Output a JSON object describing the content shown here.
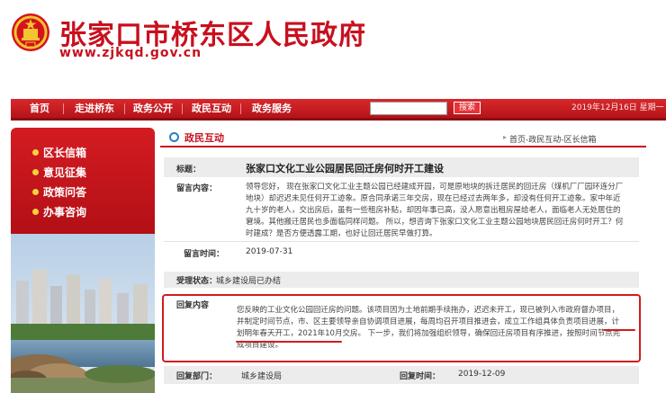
{
  "site": {
    "title": "张家口市桥东区人民政府",
    "url": "www.zjkqd.gov.cn"
  },
  "nav": {
    "items": [
      "首页",
      "走进桥东",
      "政务公开",
      "政民互动",
      "政务服务"
    ],
    "search_placeholder": "",
    "search_button": "搜索",
    "date": "2019年12月16日  星期一"
  },
  "sidebar": {
    "items": [
      "区长信箱",
      "意见征集",
      "政策问答",
      "办事咨询"
    ]
  },
  "section": {
    "title": "政民互动",
    "breadcrumb": "首页-政民互动-区长信箱"
  },
  "detail": {
    "title_label": "标题：",
    "title_value": "张家口文化工业公园居民回迁房何时开工建设",
    "message_label": "留言内容：",
    "message_text": "领导您好， 现在张家口文化工业主题公园已经建成开园，可是原地块的拆迁居民的回迁房（煤机厂厂园环连分厂地块）却迟迟未见任何开工迹象。原合同承诺三年交房，现在已经过去两年多，却没有任何开工迹象。家中年近九十岁的老人，交出房后，虽有一些租房补贴，却因年事已高，没人愿意出租房屋给老人，面临老人无处居住的窘境。其他搬迁居民也多面临同样问题。 所以，想咨询下张家口文化工业主题公园地块居民回迁房何时开工？何时建成？是否方便透露工期，也好让回迁居民早做打算。",
    "time_label": "留言时间：",
    "time_value": "2019-07-31",
    "status_label": "受理状态：",
    "status_value": "城乡建设局已办结",
    "reply_label": "回复内容",
    "reply_text": "您反映的工业文化公园回迁房的问题。该项目因为土地前期手续拖办，迟迟未开工，现已被列入市政府督办项目，并制定时间节点，市、区主要领导亲自协调项目进展，每周均召开项目推进会，成立工作组具体负责项目进展，计划明年春天开工，2021年10月交房。 下一步，我们将加强组织领导，确保回迁房项目有序推进，按照时间节点完成项目建设。",
    "dept_label": "回复部门：",
    "dept_value": "城乡建设局",
    "reply_time_label": "回复时间：",
    "reply_time_value": "2019-12-09"
  },
  "colors": {
    "brand_red": "#c8101e",
    "highlight": "#d21c1c",
    "dot": "#f6d23a"
  }
}
